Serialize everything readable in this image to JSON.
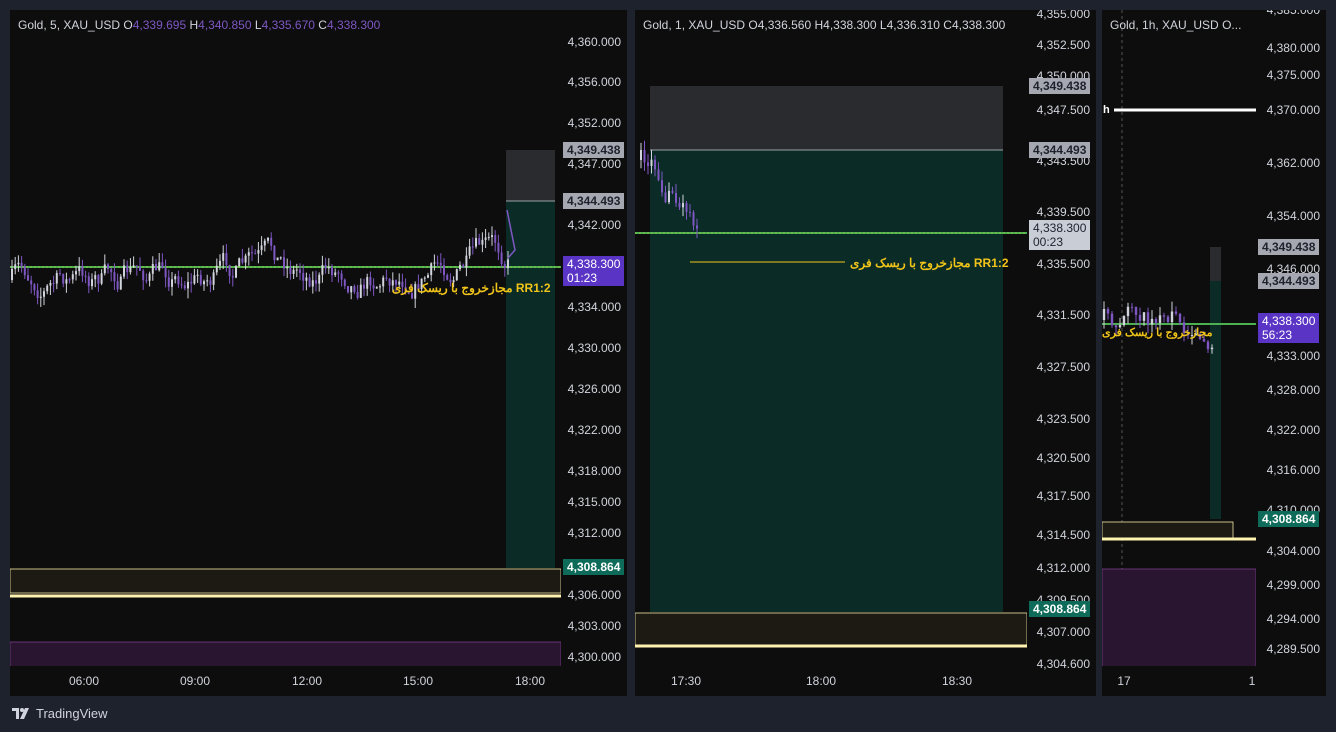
{
  "colors": {
    "accent": "#7e57c2",
    "green": "#4caf50",
    "tp": "#0f6b59",
    "sl": "#a5a8b0",
    "up": "#d1d4dc",
    "down": "#7e57c2"
  },
  "panes": [
    {
      "legend": {
        "symbol": "Gold, 5, XAU_USD",
        "o_key": "O",
        "o": "4,339.695",
        "h_key": "H",
        "h": "4,340.850",
        "l_key": "L",
        "l": "4,335.670",
        "c_key": "C",
        "c": "4,338.300"
      },
      "price_ticks": [
        "4,360.000",
        "4,356.000",
        "4,352.000",
        "4,347.000",
        "4,342.000",
        "4,334.000",
        "4,330.000",
        "4,326.000",
        "4,322.000",
        "4,318.000",
        "4,315.000",
        "4,312.000",
        "4,306.000",
        "4,303.000",
        "4,300.000"
      ],
      "tags": {
        "sl": "4,349.438",
        "entry": "4,344.493",
        "price": "4,338.300",
        "countdown": "01:23",
        "tp": "4,308.864"
      },
      "time_labels": [
        "06:00",
        "09:00",
        "12:00",
        "15:00",
        "18:00"
      ],
      "annotation": "مجازخروج با ریسک فری RR1:2"
    },
    {
      "legend": {
        "symbol": "Gold, 1, XAU_USD",
        "o_key": "O",
        "o": "4,336.560",
        "h_key": "H",
        "h": "4,338.300",
        "l_key": "L",
        "l": "4,336.310",
        "c_key": "C",
        "c": "4,338.300"
      },
      "price_ticks": [
        "4,355.000",
        "4,352.500",
        "4,350.000",
        "4,347.500",
        "4,343.500",
        "4,339.500",
        "4,335.500",
        "4,331.500",
        "4,327.500",
        "4,323.500",
        "4,320.500",
        "4,317.500",
        "4,314.500",
        "4,312.000",
        "4,309.500",
        "4,307.000",
        "4,304.600"
      ],
      "tags": {
        "sl": "4,349.438",
        "entry": "4,344.493",
        "price": "4,338.300",
        "countdown": "00:23",
        "tp": "4,308.864"
      },
      "time_labels": [
        "17:30",
        "18:00",
        "18:30"
      ],
      "annotation": "مجازخروج با ریسک فری RR1:2"
    },
    {
      "legend": {
        "symbol": "Gold, 1h, XAU_USD",
        "o_key": "O...",
        "o": "",
        "h_key": "",
        "h": "",
        "l_key": "",
        "l": "",
        "c_key": "",
        "c": ""
      },
      "price_ticks": [
        "4,385.000",
        "4,380.000",
        "4,375.000",
        "4,370.000",
        "4,362.000",
        "4,354.000",
        "4,346.000",
        "4,333.000",
        "4,328.000",
        "4,322.000",
        "4,316.000",
        "4,310.000",
        "4,304.000",
        "4,299.000",
        "4,294.000",
        "4,289.500"
      ],
      "tags": {
        "sl": "4,349.438",
        "entry": "4,344.493",
        "price": "4,338.300",
        "countdown": "56:23",
        "tp": "4,308.864"
      },
      "time_labels": [
        "17",
        "1"
      ],
      "annotation": "مجازخروج با ریسک فری",
      "h_label": "h"
    }
  ],
  "footer": {
    "brand": "TradingView",
    "logo": "tradingview-logo-icon"
  }
}
